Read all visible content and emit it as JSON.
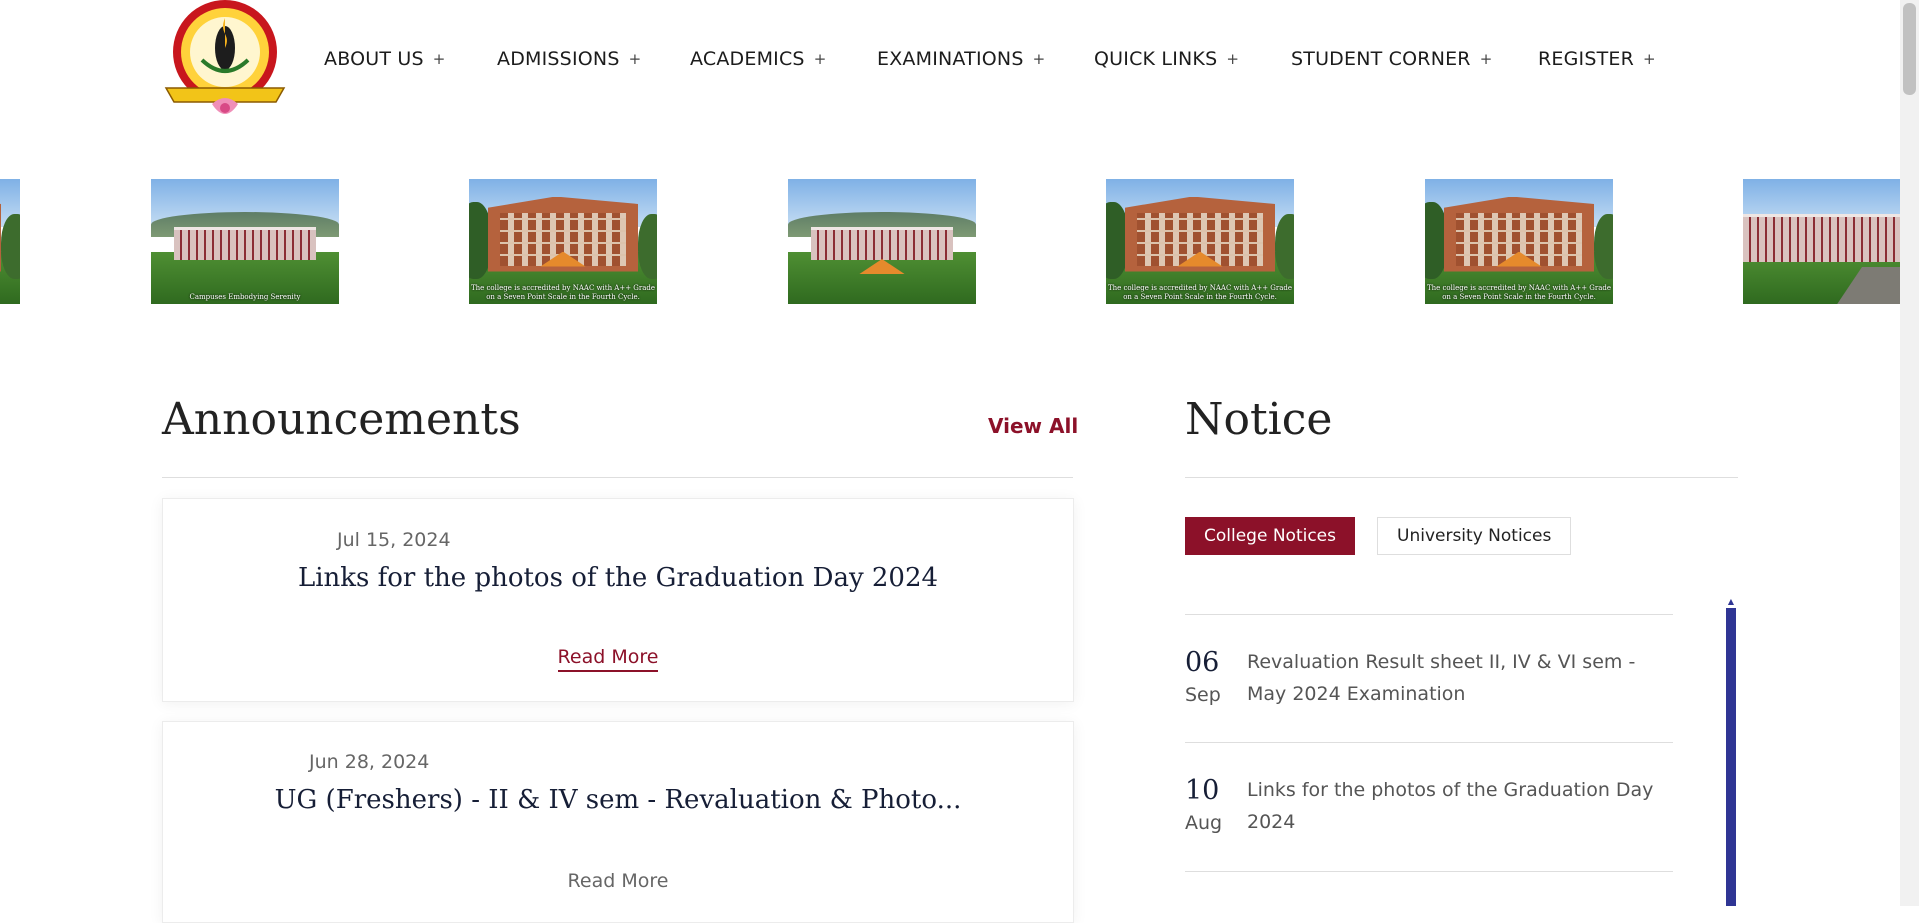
{
  "header": {
    "logo": {
      "name": "college-emblem"
    },
    "nav": [
      {
        "label": "ABOUT US",
        "icon": "+"
      },
      {
        "label": "ADMISSIONS",
        "icon": "+"
      },
      {
        "label": "ACADEMICS",
        "icon": "+"
      },
      {
        "label": "EXAMINATIONS",
        "icon": "+"
      },
      {
        "label": "QUICK LINKS",
        "icon": "+"
      },
      {
        "label": "STUDENT CORNER",
        "icon": "+"
      },
      {
        "label": "REGISTER",
        "icon": "+"
      }
    ]
  },
  "slider": {
    "captions": [
      "Campuses Embodying Serenity",
      "The college is accredited by NAAC with A++ Grade on a Seven Point Scale in the Fourth Cycle.",
      "The college is accredited by NAAC with A++ Grade on a Seven Point Scale in the Fourth Cycle.",
      "The college is accredited by NAAC with A++ Grade on a Seven Point Scale in the Fourth Cycle."
    ]
  },
  "announcements": {
    "title": "Announcements",
    "view_all": "View All",
    "items": [
      {
        "date": "Jul 15, 2024",
        "title": "Links for the photos of the Graduation Day 2024",
        "more": "Read More"
      },
      {
        "date": "Jun 28, 2024",
        "title": "UG (Freshers) - II & IV sem - Revaluation & Photo...",
        "more": "Read More"
      }
    ]
  },
  "notice": {
    "title": "Notice",
    "tabs": [
      "College Notices",
      "University Notices"
    ],
    "active_tab": "College Notices",
    "items": [
      {
        "day": "06",
        "month": "Sep",
        "text": "Revaluation Result sheet II, IV & VI sem - May 2024 Examination"
      },
      {
        "day": "10",
        "month": "Aug",
        "text": "Links for the photos of the Graduation Day 2024"
      }
    ]
  },
  "colors": {
    "accent": "#8c1129",
    "scrollbar": "#2f3594",
    "heading": "#161e36"
  }
}
